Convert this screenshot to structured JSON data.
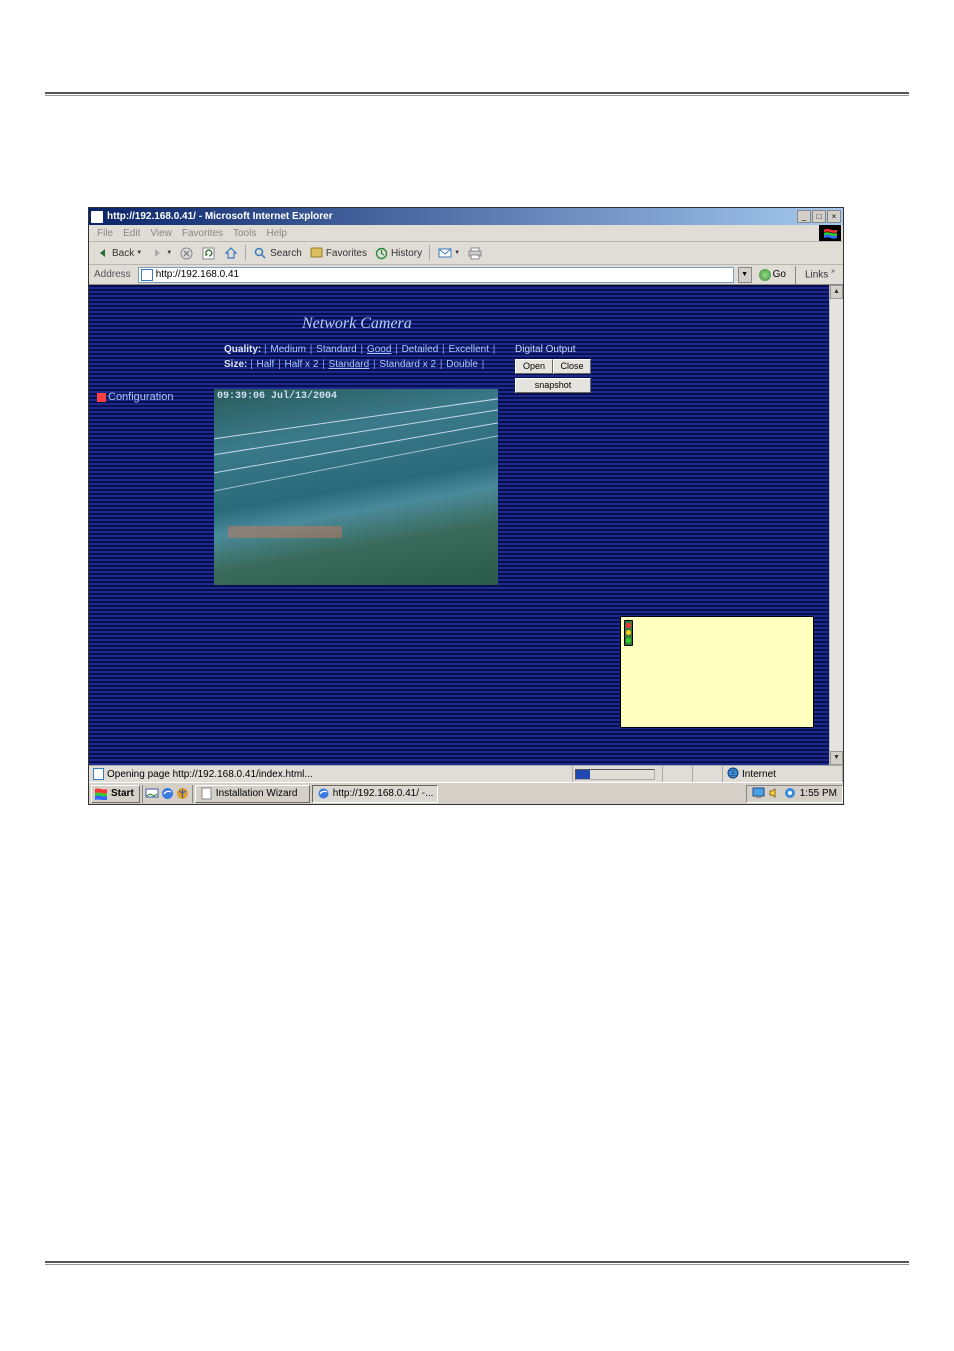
{
  "window": {
    "title": "http://192.168.0.41/ - Microsoft Internet Explorer",
    "min": "_",
    "max": "□",
    "close": "×"
  },
  "menubar": [
    "File",
    "Edit",
    "View",
    "Favorites",
    "Tools",
    "Help"
  ],
  "toolbar": {
    "back": "Back",
    "search": "Search",
    "favorites": "Favorites",
    "history": "History"
  },
  "addressbar": {
    "label": "Address",
    "url": "http://192.168.0.41",
    "go": "Go",
    "links": "Links"
  },
  "camera": {
    "title": "Network Camera",
    "quality_label": "Quality:",
    "quality_opts": [
      "Medium",
      "Standard",
      "Good",
      "Detailed",
      "Excellent"
    ],
    "quality_selected": 2,
    "size_label": "Size:",
    "size_opts": [
      "Half",
      "Half x 2",
      "Standard",
      "Standard x 2",
      "Double"
    ],
    "size_selected": 2,
    "config": "Configuration",
    "timestamp": "09:39:06 Jul/13/2004",
    "digital_output": "Digital Output",
    "open": "Open",
    "close": "Close",
    "snapshot": "snapshot"
  },
  "statusbar": {
    "text": "Opening page http://192.168.0.41/index.html...",
    "zone": "Internet"
  },
  "taskbar": {
    "start": "Start",
    "items": [
      {
        "label": "Installation Wizard",
        "pressed": false
      },
      {
        "label": "http://192.168.0.41/ -...",
        "pressed": true
      }
    ],
    "time": "1:55 PM"
  }
}
